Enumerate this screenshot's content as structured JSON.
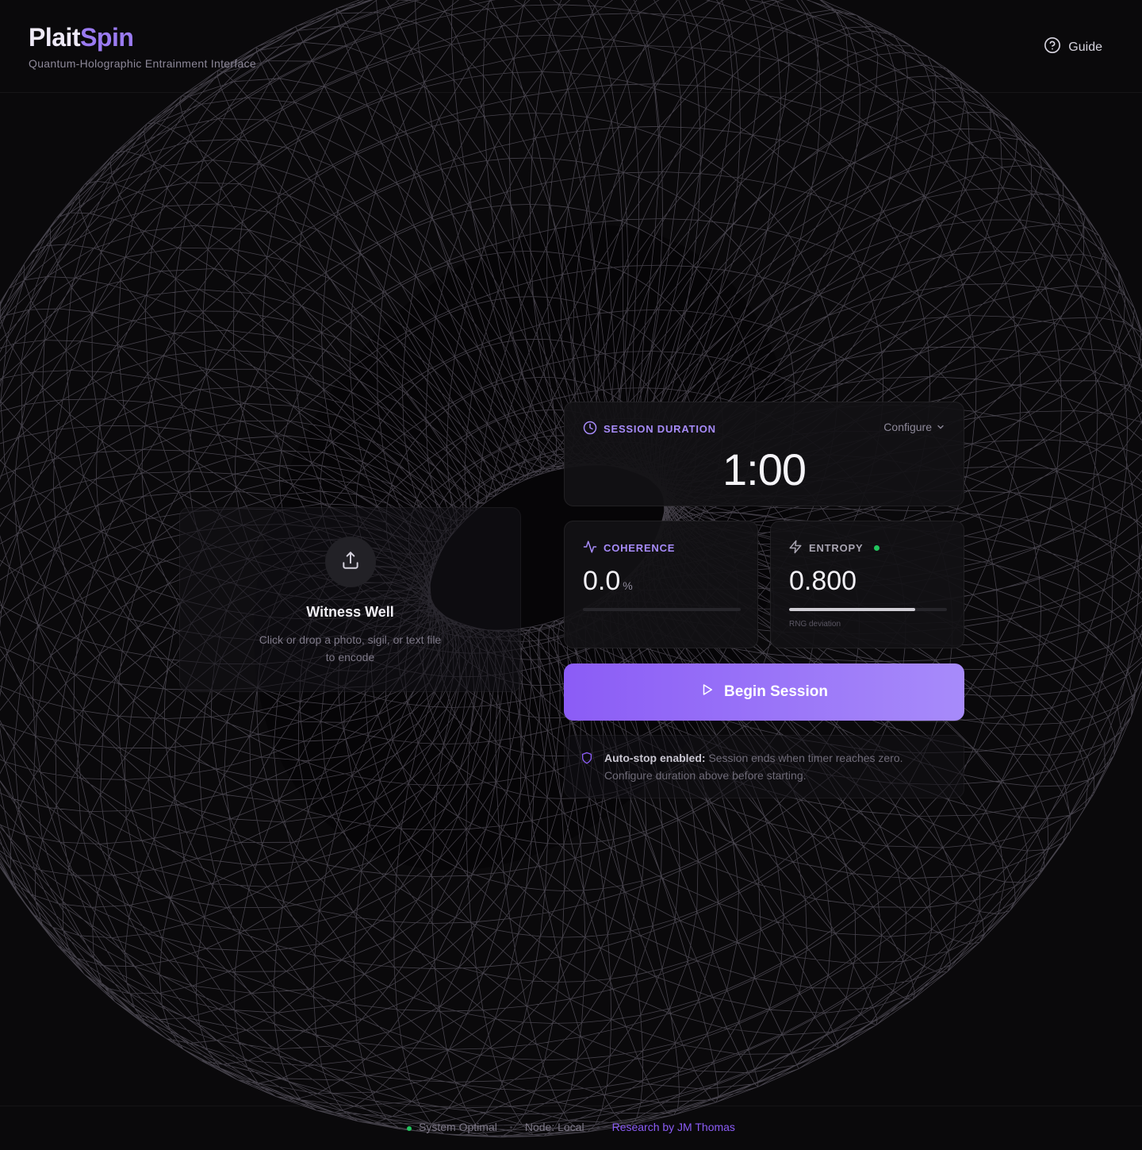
{
  "brand": {
    "logo_part1": "Plait",
    "logo_part2": "Spin",
    "tagline": "Quantum-Holographic Entrainment Interface"
  },
  "header": {
    "guide_label": "Guide",
    "guide_icon": "help-circle-icon"
  },
  "witness_well": {
    "title": "Witness Well",
    "description": "Click or drop a photo, sigil, or text file to encode",
    "icon": "upload-icon"
  },
  "session": {
    "label": "SESSION DURATION",
    "configure_label": "Configure",
    "timer": "1:00",
    "icon": "clock-icon"
  },
  "coherence": {
    "label": "COHERENCE",
    "value": "0.0",
    "unit": "%",
    "progress": 0.0,
    "icon": "activity-icon"
  },
  "entropy": {
    "label": "ENTROPY",
    "value": "0.800",
    "progress": 0.8,
    "note": "RNG deviation",
    "status": "active",
    "icon": "zap-icon"
  },
  "begin_button": {
    "label": "Begin Session",
    "icon": "play-icon"
  },
  "notice": {
    "title": "Auto-stop enabled:",
    "text": "Session ends when timer reaches zero. Configure duration above before starting.",
    "icon": "shield-icon"
  },
  "footer": {
    "status": "System Optimal",
    "node": "Node: Local",
    "credit": "Research by JM Thomas"
  },
  "colors": {
    "accent": "#a78bfa",
    "accent_strong": "#8b5cf6",
    "background": "#0a090b",
    "status_ok": "#22c55e",
    "mesh_line": "#c8bfd8"
  }
}
